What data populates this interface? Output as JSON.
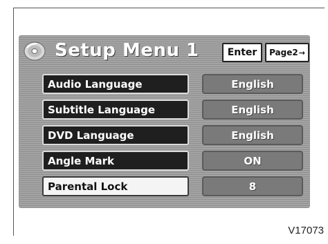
{
  "header": {
    "title": "Setup Menu 1",
    "icon": "disc-icon",
    "enter_label": "Enter",
    "page2_label": "Page2",
    "page2_arrow": "→"
  },
  "settings": [
    {
      "label": "Audio Language",
      "value": "English",
      "selected": false
    },
    {
      "label": "Subtitle Language",
      "value": "English",
      "selected": false
    },
    {
      "label": "DVD Language",
      "value": "English",
      "selected": false
    },
    {
      "label": "Angle Mark",
      "value": "ON",
      "selected": false
    },
    {
      "label": "Parental Lock",
      "value": "8",
      "selected": true
    }
  ],
  "figure_code": "V17073",
  "colors": {
    "screen_bg": "#9a9a9a",
    "label_bg": "#1f1f1f",
    "selected_bg": "#f4f4f4",
    "value_bg": "#7a7a7a"
  }
}
